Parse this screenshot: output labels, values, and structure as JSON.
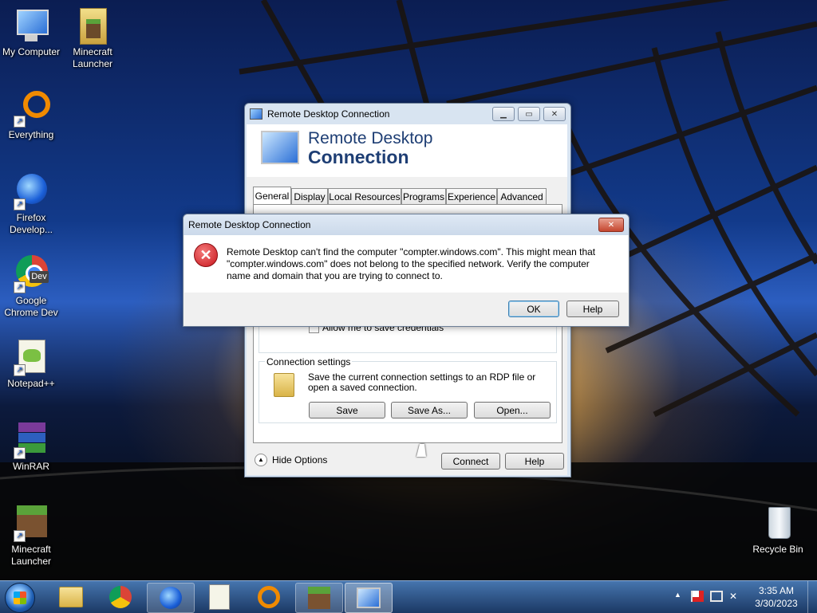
{
  "desktop": {
    "icons": [
      {
        "label": "My Computer"
      },
      {
        "label": "Minecraft Launcher"
      },
      {
        "label": "Everything"
      },
      {
        "label": "Firefox Develop..."
      },
      {
        "label": "Google Chrome Dev"
      },
      {
        "label": "Notepad++"
      },
      {
        "label": "WinRAR"
      },
      {
        "label": "Minecraft Launcher"
      },
      {
        "label": "Recycle Bin"
      }
    ]
  },
  "rdp_window": {
    "title": "Remote Desktop Connection",
    "header_line1": "Remote Desktop",
    "header_line2": "Connection",
    "tabs": [
      "General",
      "Display",
      "Local Resources",
      "Programs",
      "Experience",
      "Advanced"
    ],
    "allow_save_credentials": "Allow me to save credentials",
    "connection_settings_title": "Connection settings",
    "connection_settings_text": "Save the current connection settings to an RDP file or open a saved connection.",
    "save_button": "Save",
    "save_as_button": "Save As...",
    "open_button": "Open...",
    "hide_options": "Hide Options",
    "connect_button": "Connect",
    "help_button": "Help"
  },
  "error_dialog": {
    "title": "Remote Desktop Connection",
    "message": "Remote Desktop can't find the computer \"compter.windows.com\". This might mean that \"compter.windows.com\" does not belong to the specified network.  Verify the computer name and domain that you are trying to connect to.",
    "ok_button": "OK",
    "help_button": "Help"
  },
  "taskbar": {
    "time": "3:35 AM",
    "date": "3/30/2023",
    "pinned": [
      "start-orb",
      "file-explorer",
      "chrome-dev",
      "firefox-dev",
      "notepad-plus-plus",
      "everything",
      "minecraft",
      "remote-desktop"
    ]
  }
}
